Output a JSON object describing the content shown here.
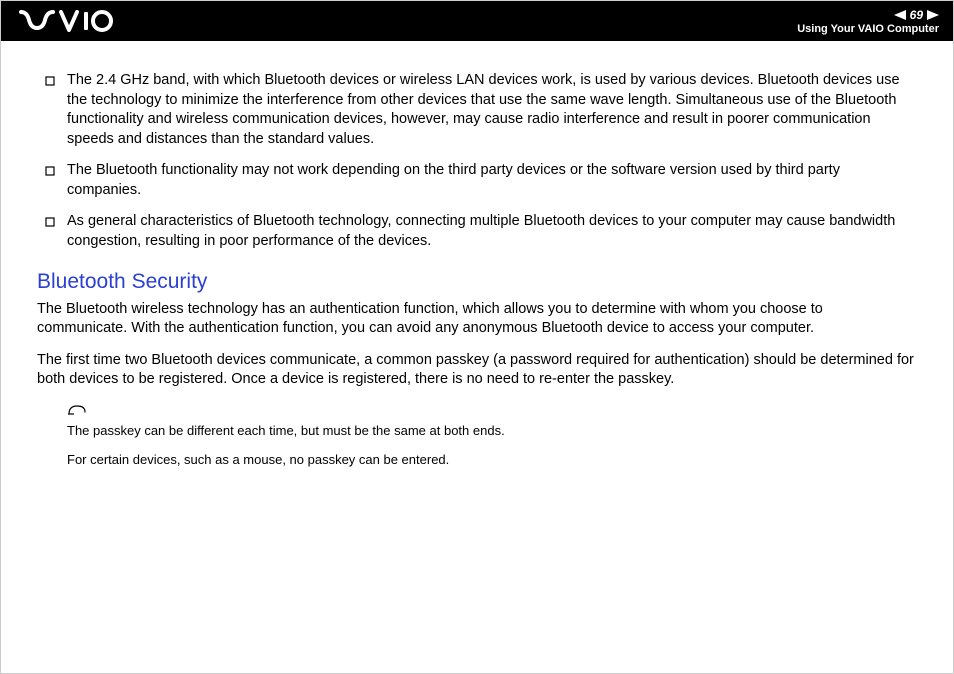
{
  "header": {
    "page_number": "69",
    "title": "Using Your VAIO Computer"
  },
  "content": {
    "bullets": [
      "The 2.4 GHz band, with which Bluetooth devices or wireless LAN devices work, is used by various devices. Bluetooth devices use the technology to minimize the interference from other devices that use the same wave length. Simultaneous use of the Bluetooth functionality and wireless communication devices, however, may cause radio interference and result in poorer communication speeds and distances than the standard values.",
      "The Bluetooth functionality may not work depending on the third party devices or the software version used by third party companies.",
      "As general characteristics of Bluetooth technology, connecting multiple Bluetooth devices to your computer may cause bandwidth congestion, resulting in poor performance of the devices."
    ],
    "heading": "Bluetooth Security",
    "para1": "The Bluetooth wireless technology has an authentication function, which allows you to determine with whom you choose to communicate. With the authentication function, you can avoid any anonymous Bluetooth device to access your computer.",
    "para2": "The first time two Bluetooth devices communicate, a common passkey (a password required for authentication) should be determined for both devices to be registered. Once a device is registered, there is no need to re-enter the passkey.",
    "note1": "The passkey can be different each time, but must be the same at both ends.",
    "note2": "For certain devices, such as a mouse, no passkey can be entered."
  }
}
